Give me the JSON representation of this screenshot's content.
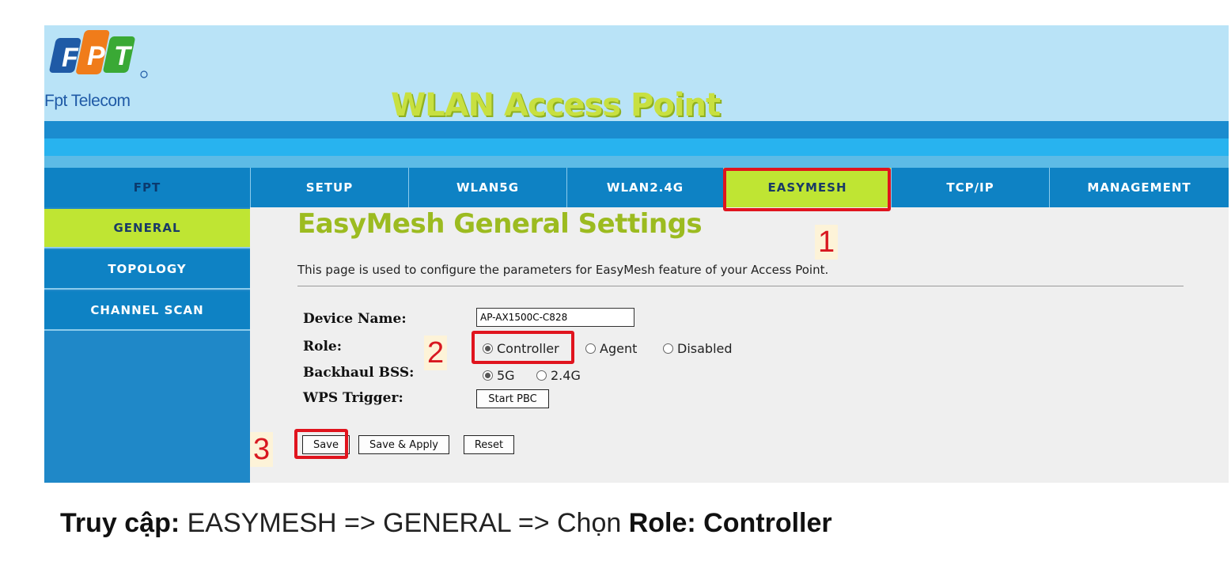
{
  "header": {
    "logo_letters": [
      "F",
      "P",
      "T"
    ],
    "logo_colors": [
      "#1f5aa6",
      "#f07c1a",
      "#3aa935"
    ],
    "logo_sub": "Fpt Telecom",
    "site_title": "WLAN Access Point"
  },
  "nav": {
    "items": [
      {
        "label": "FPT",
        "active": false
      },
      {
        "label": "SETUP",
        "active": false
      },
      {
        "label": "WLAN5G",
        "active": false
      },
      {
        "label": "WLAN2.4G",
        "active": false
      },
      {
        "label": "EASYMESH",
        "active": true
      },
      {
        "label": "TCP/IP",
        "active": false
      },
      {
        "label": "MANAGEMENT",
        "active": false
      }
    ]
  },
  "sidebar": {
    "items": [
      {
        "label": "GENERAL",
        "active": true
      },
      {
        "label": "TOPOLOGY",
        "active": false
      },
      {
        "label": "CHANNEL SCAN",
        "active": false
      }
    ]
  },
  "main": {
    "title": "EasyMesh General Settings",
    "description": "This page is used to configure the parameters for EasyMesh feature of your Access Point.",
    "device_name_label": "Device Name:",
    "device_name_value": "AP-AX1500C-C828",
    "role_label": "Role:",
    "role_options": [
      {
        "label": "Controller",
        "selected": true
      },
      {
        "label": "Agent",
        "selected": false
      },
      {
        "label": "Disabled",
        "selected": false
      }
    ],
    "backhaul_label": "Backhaul BSS:",
    "backhaul_options": [
      {
        "label": "5G",
        "selected": true
      },
      {
        "label": "2.4G",
        "selected": false
      }
    ],
    "wps_label": "WPS Trigger:",
    "wps_button": "Start PBC",
    "save_button": "Save",
    "save_apply_button": "Save & Apply",
    "reset_button": "Reset"
  },
  "annotations": {
    "step1": "1",
    "step2": "2",
    "step3": "3",
    "highlight_color": "#e0141e"
  },
  "caption": {
    "part1": "Truy cập:",
    "part2": " EASYMESH => GENERAL => Chọn ",
    "part3": "Role: Controller"
  }
}
